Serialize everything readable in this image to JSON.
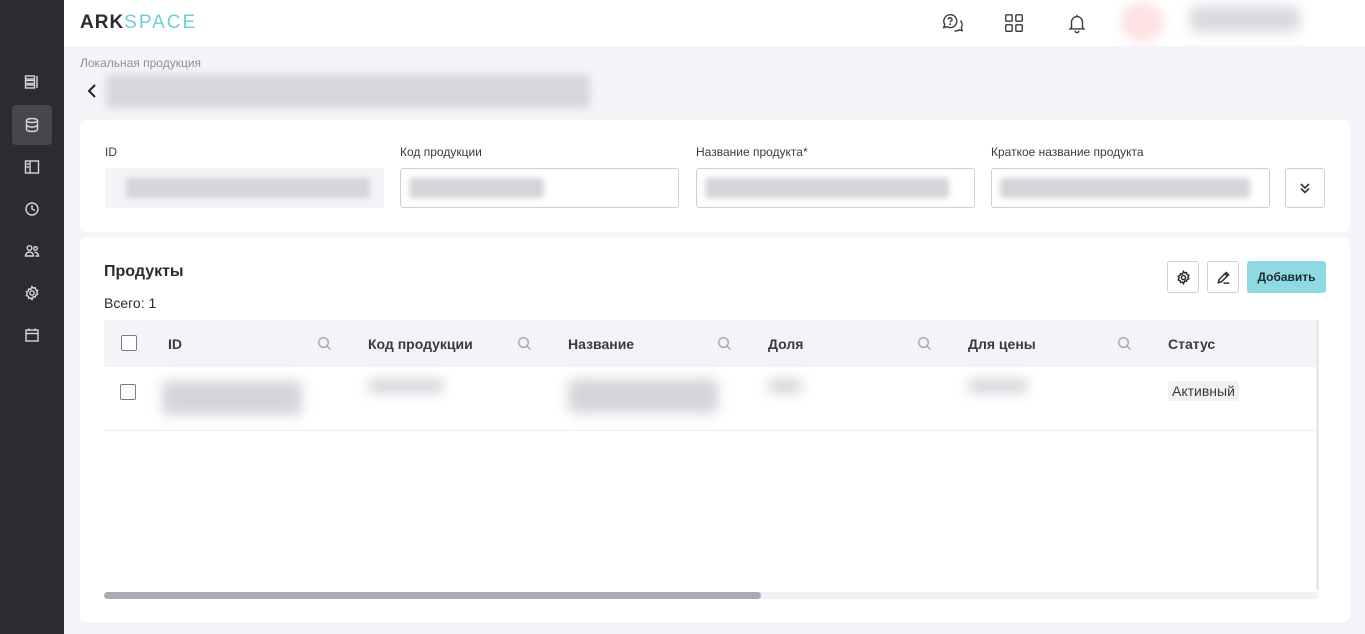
{
  "header": {
    "logo_part1": "ARK",
    "logo_part2": "SPACE"
  },
  "icons": {
    "sidebar": [
      "list-icon",
      "database-icon",
      "sidebar-panel-icon",
      "clock-icon",
      "users-icon",
      "gear-icon",
      "calendar-icon"
    ],
    "header": [
      "help-chat-icon",
      "apps-grid-icon",
      "bell-icon"
    ]
  },
  "breadcrumb": "Локальная продукция",
  "form": {
    "fields": [
      {
        "label": "ID"
      },
      {
        "label": "Код продукции"
      },
      {
        "label": "Название продукта*"
      },
      {
        "label": "Краткое название продукта"
      }
    ]
  },
  "products": {
    "title": "Продукты",
    "total": "Всего: 1",
    "add_label": "Добавить",
    "columns": [
      "ID",
      "Код продукции",
      "Название",
      "Доля",
      "Для цены",
      "Статус"
    ],
    "rows": [
      {
        "status": "Активный"
      }
    ]
  },
  "colors": {
    "sidebar_bg": "#2b2c2f",
    "accent": "#8fd9e2",
    "logo_accent": "#6fcfd8"
  }
}
